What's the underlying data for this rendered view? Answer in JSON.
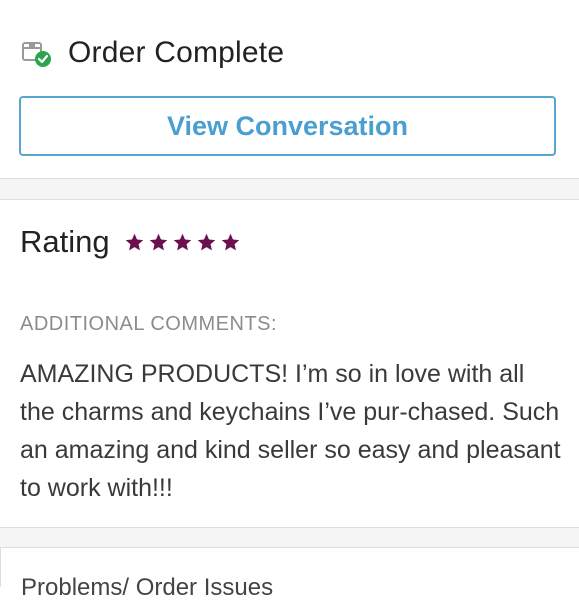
{
  "status": {
    "title": "Order Complete",
    "icon": "package-check-icon"
  },
  "actions": {
    "view_conversation": "View Conversation"
  },
  "rating": {
    "label": "Rating",
    "stars": 5,
    "max": 5,
    "star_color": "#6b0f4f"
  },
  "comments": {
    "label": "ADDITIONAL COMMENTS:",
    "text": "AMAZING PRODUCTS! I’m so in love with all the charms and keychains I’ve pur-chased. Such an amazing and kind seller so easy and pleasant to work with!!!"
  },
  "bottom_card": {
    "text": "Problems/ Order Issues"
  },
  "colors": {
    "accent": "#4a9fd0",
    "success": "#2ea44f",
    "muted": "#8c8c8c"
  }
}
